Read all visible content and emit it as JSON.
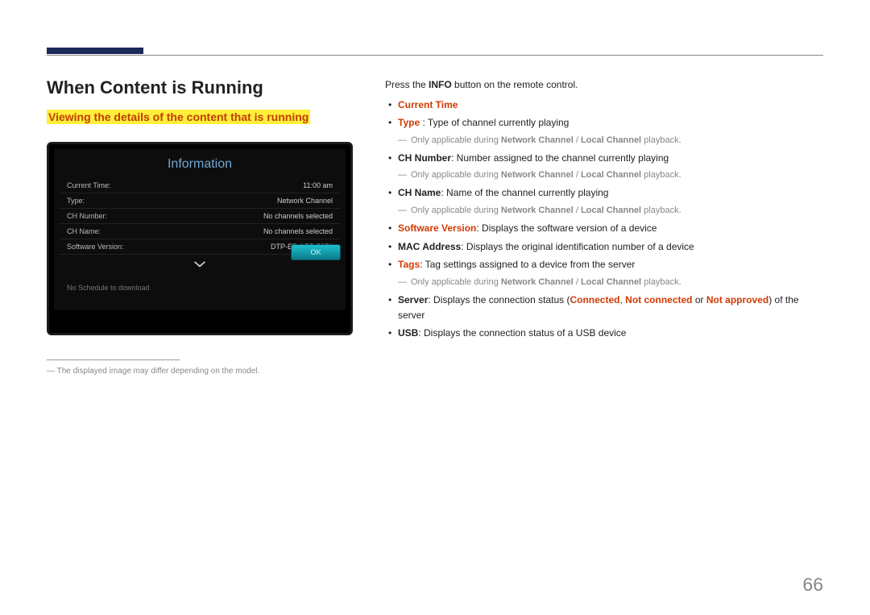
{
  "page_number": "66",
  "section_title": "When Content is Running",
  "subtitle": "Viewing the details of the content that is running",
  "device": {
    "panel_title": "Information",
    "rows": [
      {
        "label": "Current Time:",
        "value": "11:00 am"
      },
      {
        "label": "Type:",
        "value": "Network Channel"
      },
      {
        "label": "CH Number:",
        "value": "No channels selected"
      },
      {
        "label": "CH Name:",
        "value": "No channels selected"
      },
      {
        "label": "Software Version:",
        "value": "DTP-EP-APP-5371"
      }
    ],
    "ok_label": "OK",
    "no_schedule": "No Schedule to download"
  },
  "footnote": "The displayed image may differ depending on the model.",
  "intro_prefix": "Press the ",
  "intro_bold": "INFO",
  "intro_suffix": " button on the remote control.",
  "sub_note": {
    "prefix": "Only applicable during ",
    "nc": "Network Channel",
    "sep": " / ",
    "lc": "Local Channel",
    "suffix": " playback."
  },
  "items": {
    "current_time": "Current Time",
    "type_label": "Type",
    "type_desc": " : Type of channel currently playing",
    "ch_number_label": "CH Number",
    "ch_number_desc": ": Number assigned to the channel currently playing",
    "ch_name_label": "CH Name",
    "ch_name_desc": ": Name of the channel currently playing",
    "sw_label": "Software Version",
    "sw_desc": ": Displays the software version of a device",
    "mac_label": "MAC Address",
    "mac_desc": ": Displays the original identification number of a device",
    "tags_label": "Tags",
    "tags_desc": ": Tag settings assigned to a device from the server",
    "server_label": "Server",
    "server_desc_pre": ": Displays the connection status (",
    "server_connected": "Connected",
    "server_sep1": ", ",
    "server_notconnected": "Not connected",
    "server_sep2": " or ",
    "server_notapproved": "Not approved",
    "server_desc_post": ") of the server",
    "usb_label": "USB",
    "usb_desc": ": Displays the connection status of a USB device"
  }
}
